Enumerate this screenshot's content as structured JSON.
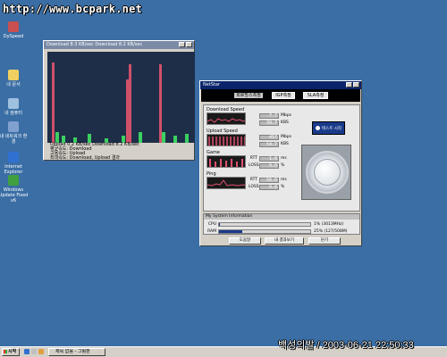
{
  "watermark": {
    "url": "http://www.bcpark.net",
    "caption": "백성의발 / 2003-06-21 22:50:33"
  },
  "desktop_icons": [
    {
      "label": "DySpeed",
      "icon": "speed-icon",
      "color": "#c85050"
    },
    {
      "label": "내 문서",
      "icon": "folder-icon",
      "color": "#f0d060"
    },
    {
      "label": "내 컴퓨터",
      "icon": "computer-icon",
      "color": "#a0c0e0"
    },
    {
      "label": "내 네트워크 환경",
      "icon": "network-icon",
      "color": "#80a0d0"
    },
    {
      "label": "Internet Explorer",
      "icon": "ie-icon",
      "color": "#3070d0"
    },
    {
      "label": "Windows Update Fixed v6",
      "icon": "windows-update-icon",
      "color": "#40a040"
    }
  ],
  "graph_window": {
    "title": "Download 8.3 KB/sec Download 8.2 KB/sec",
    "lines": [
      "Upload 0.2 KB/sec Download 8.2 KB/sec",
      "평균속도: Download",
      "고용속도: Upload",
      "최대속도: Download, Upload 결과"
    ],
    "bars": [
      {
        "pos": 0.03,
        "h": 0.88,
        "c": "#d0506a"
      },
      {
        "pos": 0.055,
        "h": 0.12,
        "c": "#3cd060"
      },
      {
        "pos": 0.1,
        "h": 0.08,
        "c": "#3cd060"
      },
      {
        "pos": 0.18,
        "h": 0.06,
        "c": "#3cd060"
      },
      {
        "pos": 0.28,
        "h": 0.1,
        "c": "#3cd060"
      },
      {
        "pos": 0.4,
        "h": 0.05,
        "c": "#3cd060"
      },
      {
        "pos": 0.52,
        "h": 0.08,
        "c": "#3cd060"
      },
      {
        "pos": 0.55,
        "h": 0.7,
        "c": "#d0506a"
      },
      {
        "pos": 0.57,
        "h": 0.86,
        "c": "#d0506a"
      },
      {
        "pos": 0.64,
        "h": 0.12,
        "c": "#3cd060"
      },
      {
        "pos": 0.78,
        "h": 0.86,
        "c": "#d0506a"
      },
      {
        "pos": 0.8,
        "h": 0.12,
        "c": "#3cd060"
      },
      {
        "pos": 0.88,
        "h": 0.08,
        "c": "#3cd060"
      },
      {
        "pos": 0.96,
        "h": 0.1,
        "c": "#3cd060"
      }
    ]
  },
  "net_window": {
    "title": "NetStar",
    "tabs": [
      "회로망스측정",
      "IGP측정",
      "SLA측정"
    ],
    "sections": {
      "download": {
        "label": "Download Speed",
        "rows": [
          {
            "label": "",
            "value": "7.7",
            "unit": "Mbps"
          },
          {
            "label": "",
            "value": "39.7",
            "unit": "KBS"
          }
        ]
      },
      "upload": {
        "label": "Upload Speed",
        "rows": [
          {
            "label": "",
            "value": "457",
            "unit": "Mbps"
          },
          {
            "label": "",
            "value": "54.7",
            "unit": "KBS"
          }
        ]
      },
      "game": {
        "label": "Game",
        "rows": [
          {
            "label": "RTT",
            "value": "1.0",
            "unit": "ms"
          },
          {
            "label": "LOSS",
            "value": "0.0",
            "unit": "%"
          }
        ]
      },
      "ping": {
        "label": "Ping",
        "rows": [
          {
            "label": "RTT",
            "value": "56.0",
            "unit": "ms"
          },
          {
            "label": "LOSS",
            "value": "0.0",
            "unit": "%"
          }
        ]
      }
    },
    "start_button": "테스트 시작",
    "sysinfo": {
      "header": "My System Information",
      "cpu": {
        "label": "CPU",
        "value": "1% (3013MHz)",
        "fill": 0.01
      },
      "ram": {
        "label": "RAM",
        "value": "25% (127/508M)",
        "fill": 0.25
      }
    },
    "buttons": [
      "도움말",
      "내 결과보기",
      "닫기"
    ]
  },
  "taskbar": {
    "start_label": "시작",
    "item": "제목 없음 - 그림판"
  }
}
